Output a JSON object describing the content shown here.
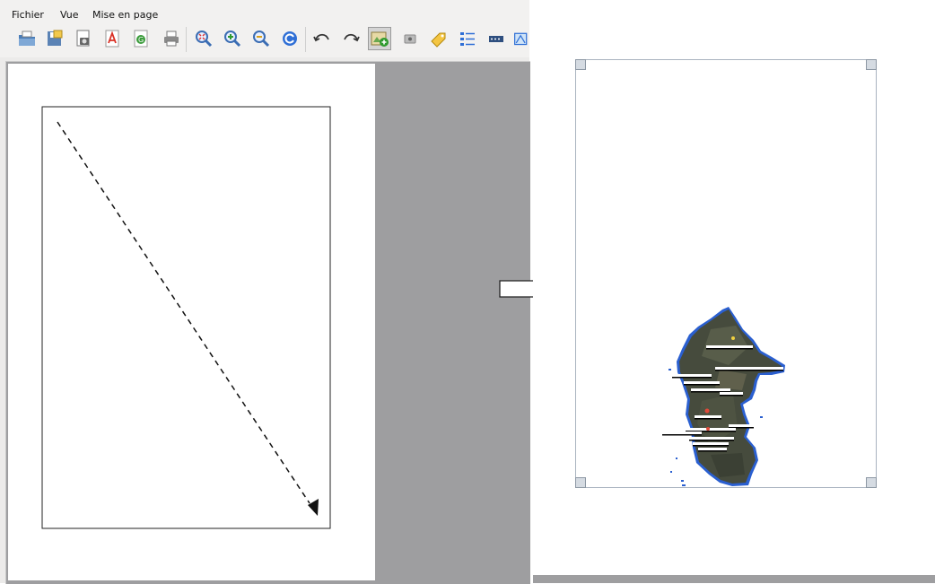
{
  "menubar": {
    "items": [
      "Fichier",
      "Vue",
      "Mise en page"
    ]
  },
  "toolbar": {
    "buttons": [
      "open-project-icon",
      "save-project-icon",
      "export-image-icon",
      "export-pdf-icon",
      "export-svg-icon",
      "print-icon",
      "zoom-full-icon",
      "zoom-in-icon",
      "zoom-out-icon",
      "refresh-icon",
      "undo-icon",
      "redo-icon",
      "add-map-icon",
      "add-image-icon",
      "add-label-icon",
      "add-legend-icon",
      "add-scalebar-icon",
      "add-shape-icon"
    ],
    "active_tool": "add-map-icon"
  },
  "colors": {
    "canvas_bg": "#9e9ea0",
    "map_frame": "#a9b3bf",
    "island_dark": "#3d4236",
    "island_mid": "#555a48",
    "island_outline": "#2a5fd0"
  }
}
